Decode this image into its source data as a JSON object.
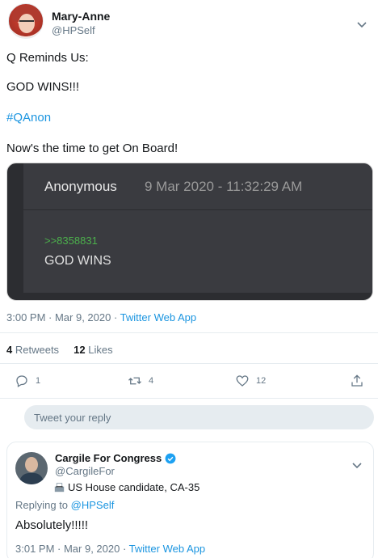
{
  "tweet": {
    "author": {
      "name": "Mary-Anne",
      "handle": "@HPSelf"
    },
    "lines": [
      "Q Reminds Us:",
      "GOD WINS!!!",
      "#QAnon",
      "Now's the time to get On Board!"
    ],
    "embed": {
      "author": "Anonymous",
      "date": "9 Mar 2020 - 11:32:29 AM",
      "quote_link": ">>8358831",
      "text": "GOD WINS"
    },
    "timestamp": "3:00 PM · Mar 9, 2020 · ",
    "app": "Twitter Web App",
    "stats": {
      "retweets_count": "4",
      "retweets_label": "Retweets",
      "likes_count": "12",
      "likes_label": "Likes"
    },
    "actions": {
      "reply_count": "1",
      "retweet_count": "4",
      "like_count": "12"
    }
  },
  "reply_box": {
    "placeholder": "Tweet your reply"
  },
  "reply": {
    "author": {
      "name": "Cargile For Congress",
      "handle": "@CargileFor"
    },
    "bio": "US House candidate, CA-35",
    "replying_prefix": "Replying to ",
    "replying_to": "@HPSelf",
    "text": "Absolutely!!!!!",
    "timestamp": "3:01 PM · Mar 9, 2020 · ",
    "app": "Twitter Web App"
  },
  "colors": {
    "accent": "#1b95e0",
    "verified": "#1da1f2",
    "green_quote": "#4cb04c"
  }
}
